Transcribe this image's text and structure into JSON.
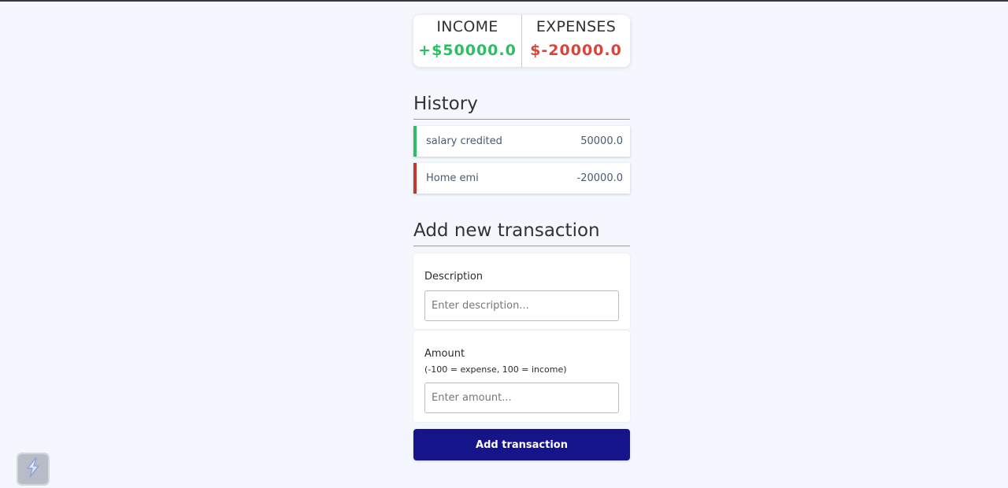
{
  "summary": {
    "income_label": "INCOME",
    "income_value": "+$50000.0",
    "expense_label": "EXPENSES",
    "expense_value": "$-20000.0"
  },
  "history": {
    "title": "History",
    "items": [
      {
        "text": "salary credited",
        "amount": "50000.0",
        "type": "plus"
      },
      {
        "text": "Home emi",
        "amount": "-20000.0",
        "type": "minus"
      }
    ]
  },
  "form": {
    "title": "Add new transaction",
    "description_label": "Description",
    "description_placeholder": "Enter description...",
    "amount_label": "Amount",
    "amount_hint": "(-100 = expense, 100 = income)",
    "amount_placeholder": "Enter amount...",
    "submit_label": "Add transaction"
  },
  "colors": {
    "income": "#2ebd63",
    "expense": "#d9453b",
    "button": "#151589",
    "background": "#f4f7fd"
  },
  "icons": {
    "floating_widget": "lightning-bolt-icon"
  }
}
